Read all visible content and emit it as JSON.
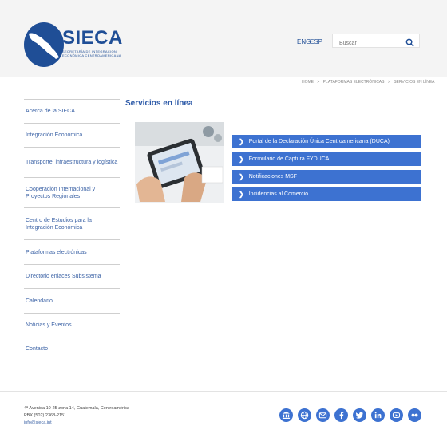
{
  "header": {
    "logo_name": "SIECA",
    "logo_sub_1": "SECRETARÍA DE INTEGRACIÓN",
    "logo_sub_2": "ECONÓMICA CENTROAMERICANA",
    "lang_eng": "ENG",
    "lang_esp": "ESP",
    "search_placeholder": "Buscar"
  },
  "breadcrumb": [
    "HOME",
    ">",
    "PLATAFORMAS ELECTRÓNICAS",
    ">",
    "SERVICIOS EN LÍNEA"
  ],
  "page_title": "Servicios en línea",
  "sidebar": {
    "items": [
      {
        "label": "Acerca de la SIECA"
      },
      {
        "label": "Integración Económica"
      },
      {
        "label": "Transporte, infraestructura y logística"
      },
      {
        "label": "Cooperación Internacional y Proyectos Regionales"
      },
      {
        "label": "Centro de Estudios para la Integración Económica"
      },
      {
        "label": "Plataformas electrónicas"
      },
      {
        "label": "Directorio enlaces Subsistema"
      },
      {
        "label": "Calendario"
      },
      {
        "label": "Noticias y Eventos"
      },
      {
        "label": "Contacto"
      }
    ]
  },
  "links": [
    {
      "label": "Portal de la Declaración Única Centroamericana (DUCA)"
    },
    {
      "label": "Formulario de Captura FYDUCA"
    },
    {
      "label": "Notificaciones MSF"
    },
    {
      "label": "Incidencias al Comercio"
    }
  ],
  "footer": {
    "address": "4ª Avenida 10-25 zona 14, Guatemala, Centroamérica",
    "phone": "PBX (502) 2368-2151",
    "email": "info@sieca.int"
  },
  "social_icons": [
    "institution-icon",
    "globe-icon",
    "mail-icon",
    "facebook-icon",
    "twitter-icon",
    "linkedin-icon",
    "youtube-icon",
    "flickr-icon"
  ],
  "colors": {
    "brand_blue": "#1f4e96",
    "button_blue": "#3d72d1",
    "link_blue": "#3c63a6"
  }
}
